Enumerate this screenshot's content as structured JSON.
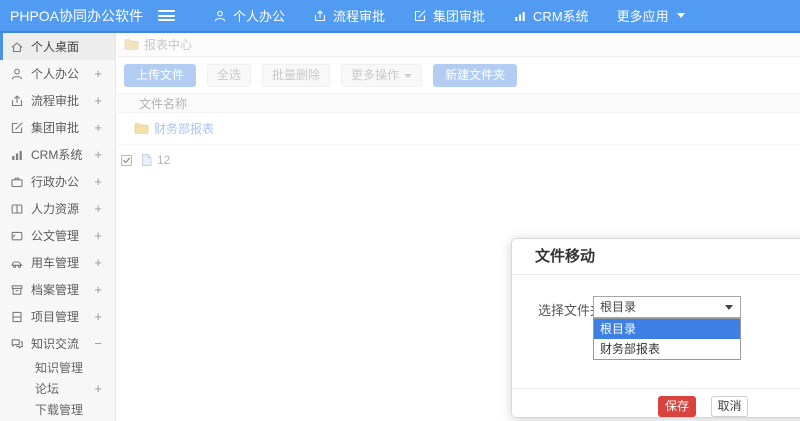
{
  "header": {
    "logo": "PHPOA协同办公软件",
    "nav": [
      {
        "icon": "user-icon",
        "label": "个人办公"
      },
      {
        "icon": "approval-icon",
        "label": "流程审批"
      },
      {
        "icon": "edit-icon",
        "label": "集团审批"
      },
      {
        "icon": "chart-icon",
        "label": "CRM系统"
      },
      {
        "icon": "caret-down-icon",
        "label": "更多应用"
      }
    ]
  },
  "sidebar": {
    "items": [
      {
        "icon": "home-icon",
        "label": "个人桌面",
        "expand": "",
        "active": true
      },
      {
        "icon": "user-icon",
        "label": "个人办公",
        "expand": "+"
      },
      {
        "icon": "approval-icon",
        "label": "流程审批",
        "expand": "+"
      },
      {
        "icon": "edit-icon",
        "label": "集团审批",
        "expand": "+"
      },
      {
        "icon": "chart-icon",
        "label": "CRM系统",
        "expand": "+"
      },
      {
        "icon": "briefcase-icon",
        "label": "行政办公",
        "expand": "+"
      },
      {
        "icon": "book-icon",
        "label": "人力资源",
        "expand": "+"
      },
      {
        "icon": "document-icon",
        "label": "公文管理",
        "expand": "+"
      },
      {
        "icon": "car-icon",
        "label": "用车管理",
        "expand": "+"
      },
      {
        "icon": "archive-icon",
        "label": "档案管理",
        "expand": "+"
      },
      {
        "icon": "project-icon",
        "label": "项目管理",
        "expand": "+"
      },
      {
        "icon": "chat-icon",
        "label": "知识交流",
        "expand": "−"
      }
    ],
    "subitems": [
      {
        "label": "知识管理",
        "expand": ""
      },
      {
        "label": "论坛",
        "expand": "+"
      },
      {
        "label": "下载管理",
        "expand": ""
      }
    ]
  },
  "breadcrumb": {
    "icon": "folder-icon",
    "label": "报表中心"
  },
  "toolbar": {
    "upload": "上传文件",
    "select_all": "全选",
    "batch_delete": "批量删除",
    "more_ops": "更多操作",
    "new_folder": "新建文件夹"
  },
  "file_table": {
    "header": "文件名称",
    "folder_row": {
      "icon": "folder-icon",
      "name": "财务部报表"
    },
    "file_row": {
      "icon": "file-icon",
      "name": "12",
      "checked": true
    }
  },
  "modal": {
    "title": "文件移动",
    "label": "选择文件夹",
    "selected_value": "根目录",
    "options": [
      "根目录",
      "财务部报表"
    ],
    "save": "保存",
    "cancel": "取消"
  },
  "colors": {
    "topbar_blue": "#519bf2",
    "accent_blue": "#4a90e5",
    "select_highlight": "#3d7fe3",
    "save_red": "#d8433e",
    "folder_yellow": "#f5dfab"
  }
}
